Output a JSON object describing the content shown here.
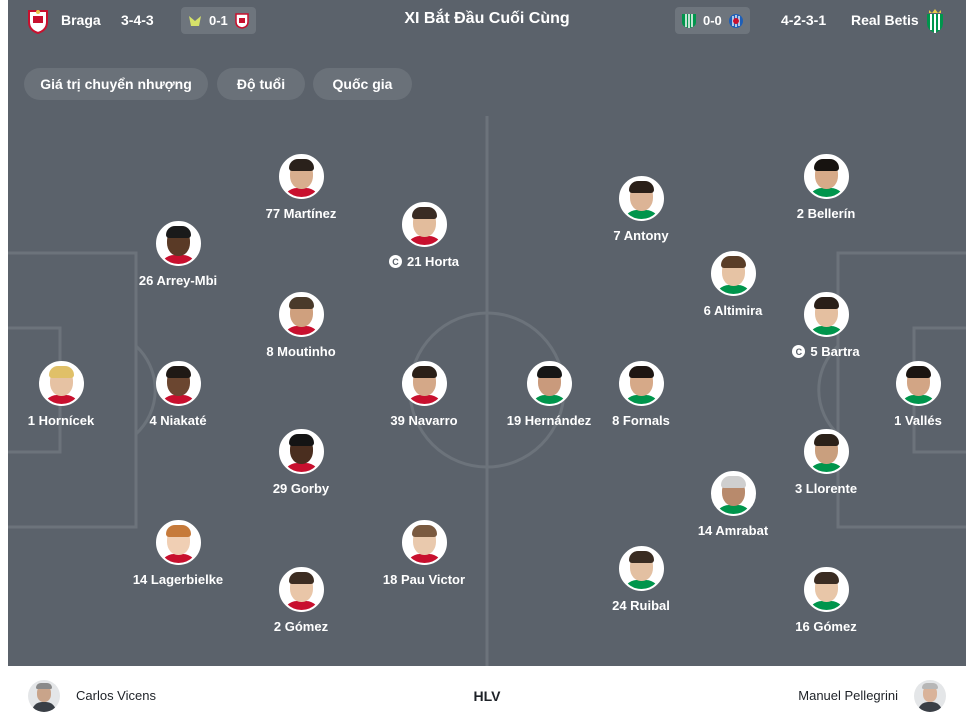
{
  "header": {
    "home_team": "Braga",
    "home_formation": "3-4-3",
    "home_prev_score": "0-1",
    "title": "XI Bắt Đầu Cuối Cùng",
    "away_prev_score": "0-0",
    "away_formation": "4-2-3-1",
    "away_team": "Real Betis"
  },
  "tabs": [
    "Giá trị chuyển nhượng",
    "Độ tuổi",
    "Quốc gia"
  ],
  "home_players": [
    {
      "label": "1 Hornícek",
      "captain": false
    },
    {
      "label": "26 Arrey-Mbi",
      "captain": false
    },
    {
      "label": "4 Niakaté",
      "captain": false
    },
    {
      "label": "14 Lagerbielke",
      "captain": false
    },
    {
      "label": "77 Martínez",
      "captain": false
    },
    {
      "label": "8 Moutinho",
      "captain": false
    },
    {
      "label": "29 Gorby",
      "captain": false
    },
    {
      "label": "2 Gómez",
      "captain": false
    },
    {
      "label": "21 Horta",
      "captain": true
    },
    {
      "label": "39 Navarro",
      "captain": false
    },
    {
      "label": "18 Pau Victor",
      "captain": false
    }
  ],
  "away_players": [
    {
      "label": "19 Hernández",
      "captain": false
    },
    {
      "label": "7 Antony",
      "captain": false
    },
    {
      "label": "8 Fornals",
      "captain": false
    },
    {
      "label": "24 Ruibal",
      "captain": false
    },
    {
      "label": "6 Altimira",
      "captain": false
    },
    {
      "label": "14 Amrabat",
      "captain": false
    },
    {
      "label": "2 Bellerín",
      "captain": false
    },
    {
      "label": "5 Bartra",
      "captain": true
    },
    {
      "label": "3 Llorente",
      "captain": false
    },
    {
      "label": "16 Gómez",
      "captain": false
    },
    {
      "label": "1 Vallés",
      "captain": false
    }
  ],
  "captain_badge": "C",
  "coaches": {
    "home": "Carlos Vicens",
    "label": "HLV",
    "away": "Manuel Pellegrini"
  },
  "colors": {
    "pitch": "#5b626b",
    "tab_bg": "#6a7179",
    "braga_red": "#c8102e",
    "betis_green": "#00954c"
  }
}
